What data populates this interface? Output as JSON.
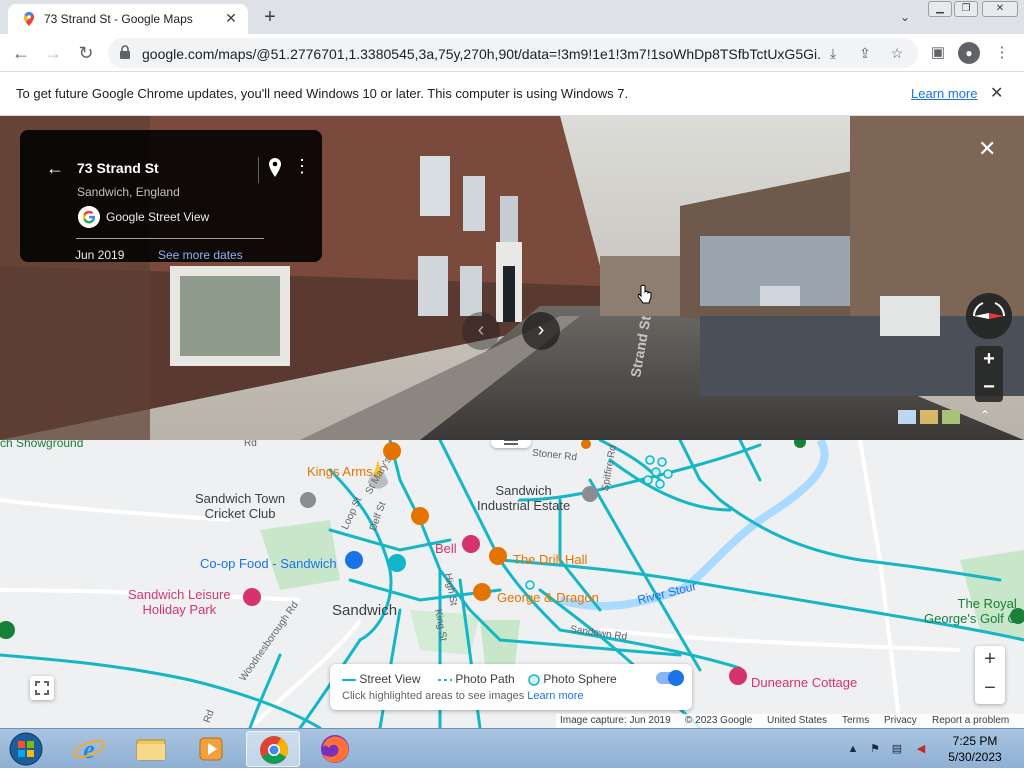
{
  "browser": {
    "tab_title": "73 Strand St - Google Maps",
    "url": "google.com/maps/@51.2776701,1.3380545,3a,75y,270h,90t/data=!3m9!1e1!3m7!1soWhDp8TSfbTctUxG5Gi...",
    "new_tab_label": "+",
    "icons": [
      "maps-favicon",
      "close-icon",
      "plus-icon",
      "chevron-down-icon",
      "minimize-icon",
      "restore-icon",
      "close-icon",
      "back-arrow-icon",
      "forward-arrow-icon",
      "reload-icon",
      "lock-icon",
      "install-icon",
      "share-icon",
      "star-icon",
      "sidepanel-icon",
      "profile-icon",
      "kebab-menu-icon"
    ]
  },
  "infobar": {
    "message": "To get future Google Chrome updates, you'll need Windows 10 or later. This computer is using Windows 7.",
    "learn_more": "Learn more"
  },
  "street_view": {
    "address": "73 Strand St",
    "locality": "Sandwich, England",
    "provider": "Google Street View",
    "capture_date": "Jun 2019",
    "see_more_dates": "See more dates",
    "street_label": "Strand St",
    "zoom_in": "+",
    "zoom_out": "−"
  },
  "map": {
    "labels": {
      "kings_arms": "Kings Arms",
      "sandwich_town_cricket": "Sandwich Town\nCricket Club",
      "sandwich_industrial": "Sandwich\nIndustrial Estate",
      "coop": "Co-op Food - Sandwich",
      "bell": "Bell",
      "drill_hall": "The Drill Hall",
      "leisure": "Sandwich Leisure\nHoliday Park",
      "sandwich": "Sandwich",
      "george_dragon": "George & Dragon",
      "river_stour": "River Stour",
      "royal_georges": "The Royal\nGeorge's Golf C",
      "dunearne": "Dunearne Cottage",
      "showground": "ch Showground",
      "stoner_rd": "Stoner Rd",
      "spitfire_rd": "Spitfire Rd",
      "high_st": "High St",
      "king_st": "King St",
      "sandown_rd": "Sandown Rd",
      "woodnesborough": "Woodnesborough Rd",
      "delf_st": "Delf St",
      "st_marys": "St Mary's",
      "loop_st": "Loop St",
      "rd_left": "Rd",
      "rd_top": "Rd"
    },
    "legend": {
      "street_view": "Street View",
      "photo_path": "Photo Path",
      "photo_sphere": "Photo Sphere",
      "hint": "Click highlighted areas to see images",
      "learn_more": "Learn more"
    },
    "zoom_in": "+",
    "zoom_out": "−",
    "footer": {
      "image_capture": "Image capture: Jun 2019",
      "copyright": "© 2023 Google",
      "country": "United States",
      "terms": "Terms",
      "privacy": "Privacy",
      "report": "Report a problem"
    },
    "colors": {
      "street_view_line": "#15b6c6",
      "poi_orange": "#e37400",
      "poi_pink": "#d6336c",
      "poi_blue": "#1a73e8",
      "water": "#aadaff",
      "park": "#c8e6c9"
    }
  },
  "taskbar": {
    "time": "7:25 PM",
    "date": "5/30/2023",
    "apps": [
      "start-orb",
      "internet-explorer",
      "file-explorer",
      "media-player",
      "chrome",
      "firefox"
    ]
  }
}
